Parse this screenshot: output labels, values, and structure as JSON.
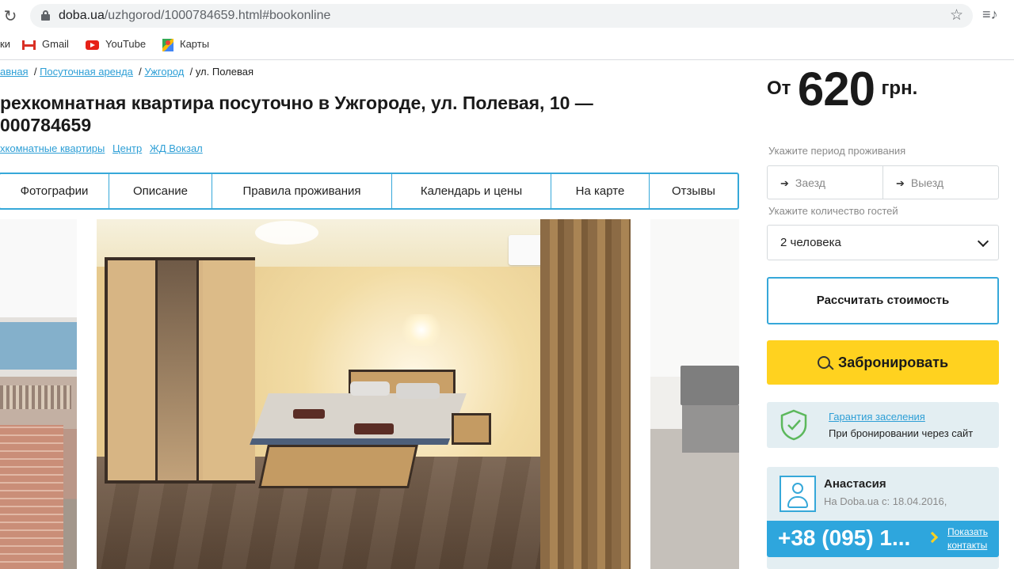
{
  "browser": {
    "url_domain": "doba.ua",
    "url_path": "/uzhgorod/1000784659.html#bookonline",
    "reload_icon": "reload-icon",
    "star_icon": "star-icon"
  },
  "bookmarks": {
    "first_partial": "ки",
    "items": [
      {
        "label": "Gmail",
        "icon": "gmail-icon"
      },
      {
        "label": "YouTube",
        "icon": "youtube-icon"
      },
      {
        "label": "Карты",
        "icon": "maps-icon"
      }
    ]
  },
  "breadcrumb": {
    "items": [
      "авная",
      "Посуточная аренда",
      "Ужгород"
    ],
    "current": "ул. Полевая"
  },
  "listing": {
    "title_line1": "рехкомнатная квартира посуточно в Ужгороде, ул. Полевая, 10 —",
    "title_line2": "000784659",
    "tags": [
      "хкомнатные квартиры",
      "Центр",
      "ЖД Вокзал"
    ]
  },
  "tabs": [
    "Фотографии",
    "Описание",
    "Правила проживания",
    "Календарь и цены",
    "На карте",
    "Отзывы"
  ],
  "booking": {
    "price_prefix": "От",
    "price": "620",
    "currency": "грн.",
    "period_label": "Укажите период проживания",
    "checkin_placeholder": "Заезд",
    "checkout_placeholder": "Выезд",
    "guests_label": "Укажите количество гостей",
    "guests_value": "2 человека",
    "calc_button": "Рассчитать стоимость",
    "book_button": "Забронировать"
  },
  "guarantee": {
    "link": "Гарантия заселения",
    "subtitle": "При бронировании через сайт"
  },
  "host": {
    "name": "Анастасия",
    "since": "На Doba.ua с: 18.04.2016,",
    "phone": "+38 (095) 1...",
    "show_contacts_line1": "Показать",
    "show_contacts_line2": "контакты"
  }
}
